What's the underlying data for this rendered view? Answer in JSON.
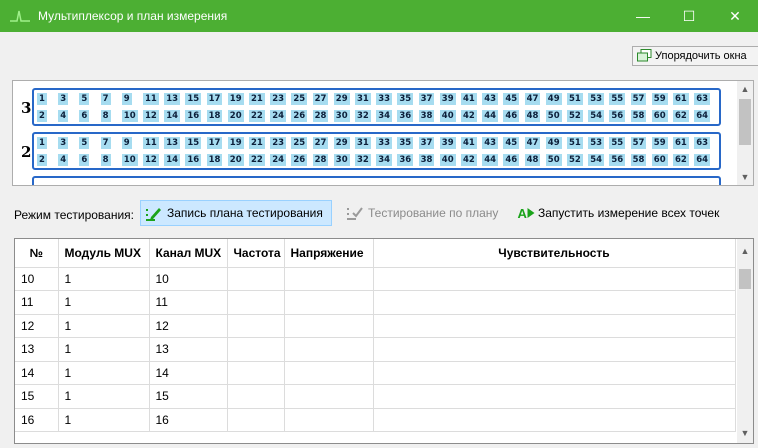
{
  "window": {
    "title": "Мультиплексор и план измерения",
    "minimize_glyph": "—",
    "maximize_glyph": "☐",
    "close_glyph": "✕"
  },
  "toolbar": {
    "arrange_label": "Упорядочить окна"
  },
  "mux_panel": {
    "modules": [
      {
        "label": "3"
      },
      {
        "label": "2"
      }
    ],
    "channel_color": "#a6dcf0",
    "border_color": "#2868c8"
  },
  "mode_bar": {
    "label": "Режим тестирования:",
    "record_plan": "Запись плана тестирования",
    "test_by_plan": "Тестирование по плану",
    "run_all": "Запустить измерение всех точек"
  },
  "table": {
    "columns": [
      "№",
      "Модуль MUX",
      "Канал MUX",
      "Частота",
      "Напряжение",
      "Чувствительность"
    ],
    "rows": [
      [
        "10",
        "1",
        "10",
        "",
        "",
        ""
      ],
      [
        "11",
        "1",
        "11",
        "",
        "",
        ""
      ],
      [
        "12",
        "1",
        "12",
        "",
        "",
        ""
      ],
      [
        "13",
        "1",
        "13",
        "",
        "",
        ""
      ],
      [
        "14",
        "1",
        "14",
        "",
        "",
        ""
      ],
      [
        "15",
        "1",
        "15",
        "",
        "",
        ""
      ],
      [
        "16",
        "1",
        "16",
        "",
        "",
        ""
      ]
    ]
  },
  "icons": {
    "app": "pulse-icon",
    "arrange": "windows-icon",
    "record": "pencil-list-icon",
    "test_plan": "checklist-icon",
    "run": "play-icon"
  },
  "colors": {
    "title_bar": "#4caf33",
    "active_button": "#cce8ff",
    "run_icon": "#1aa31a"
  }
}
